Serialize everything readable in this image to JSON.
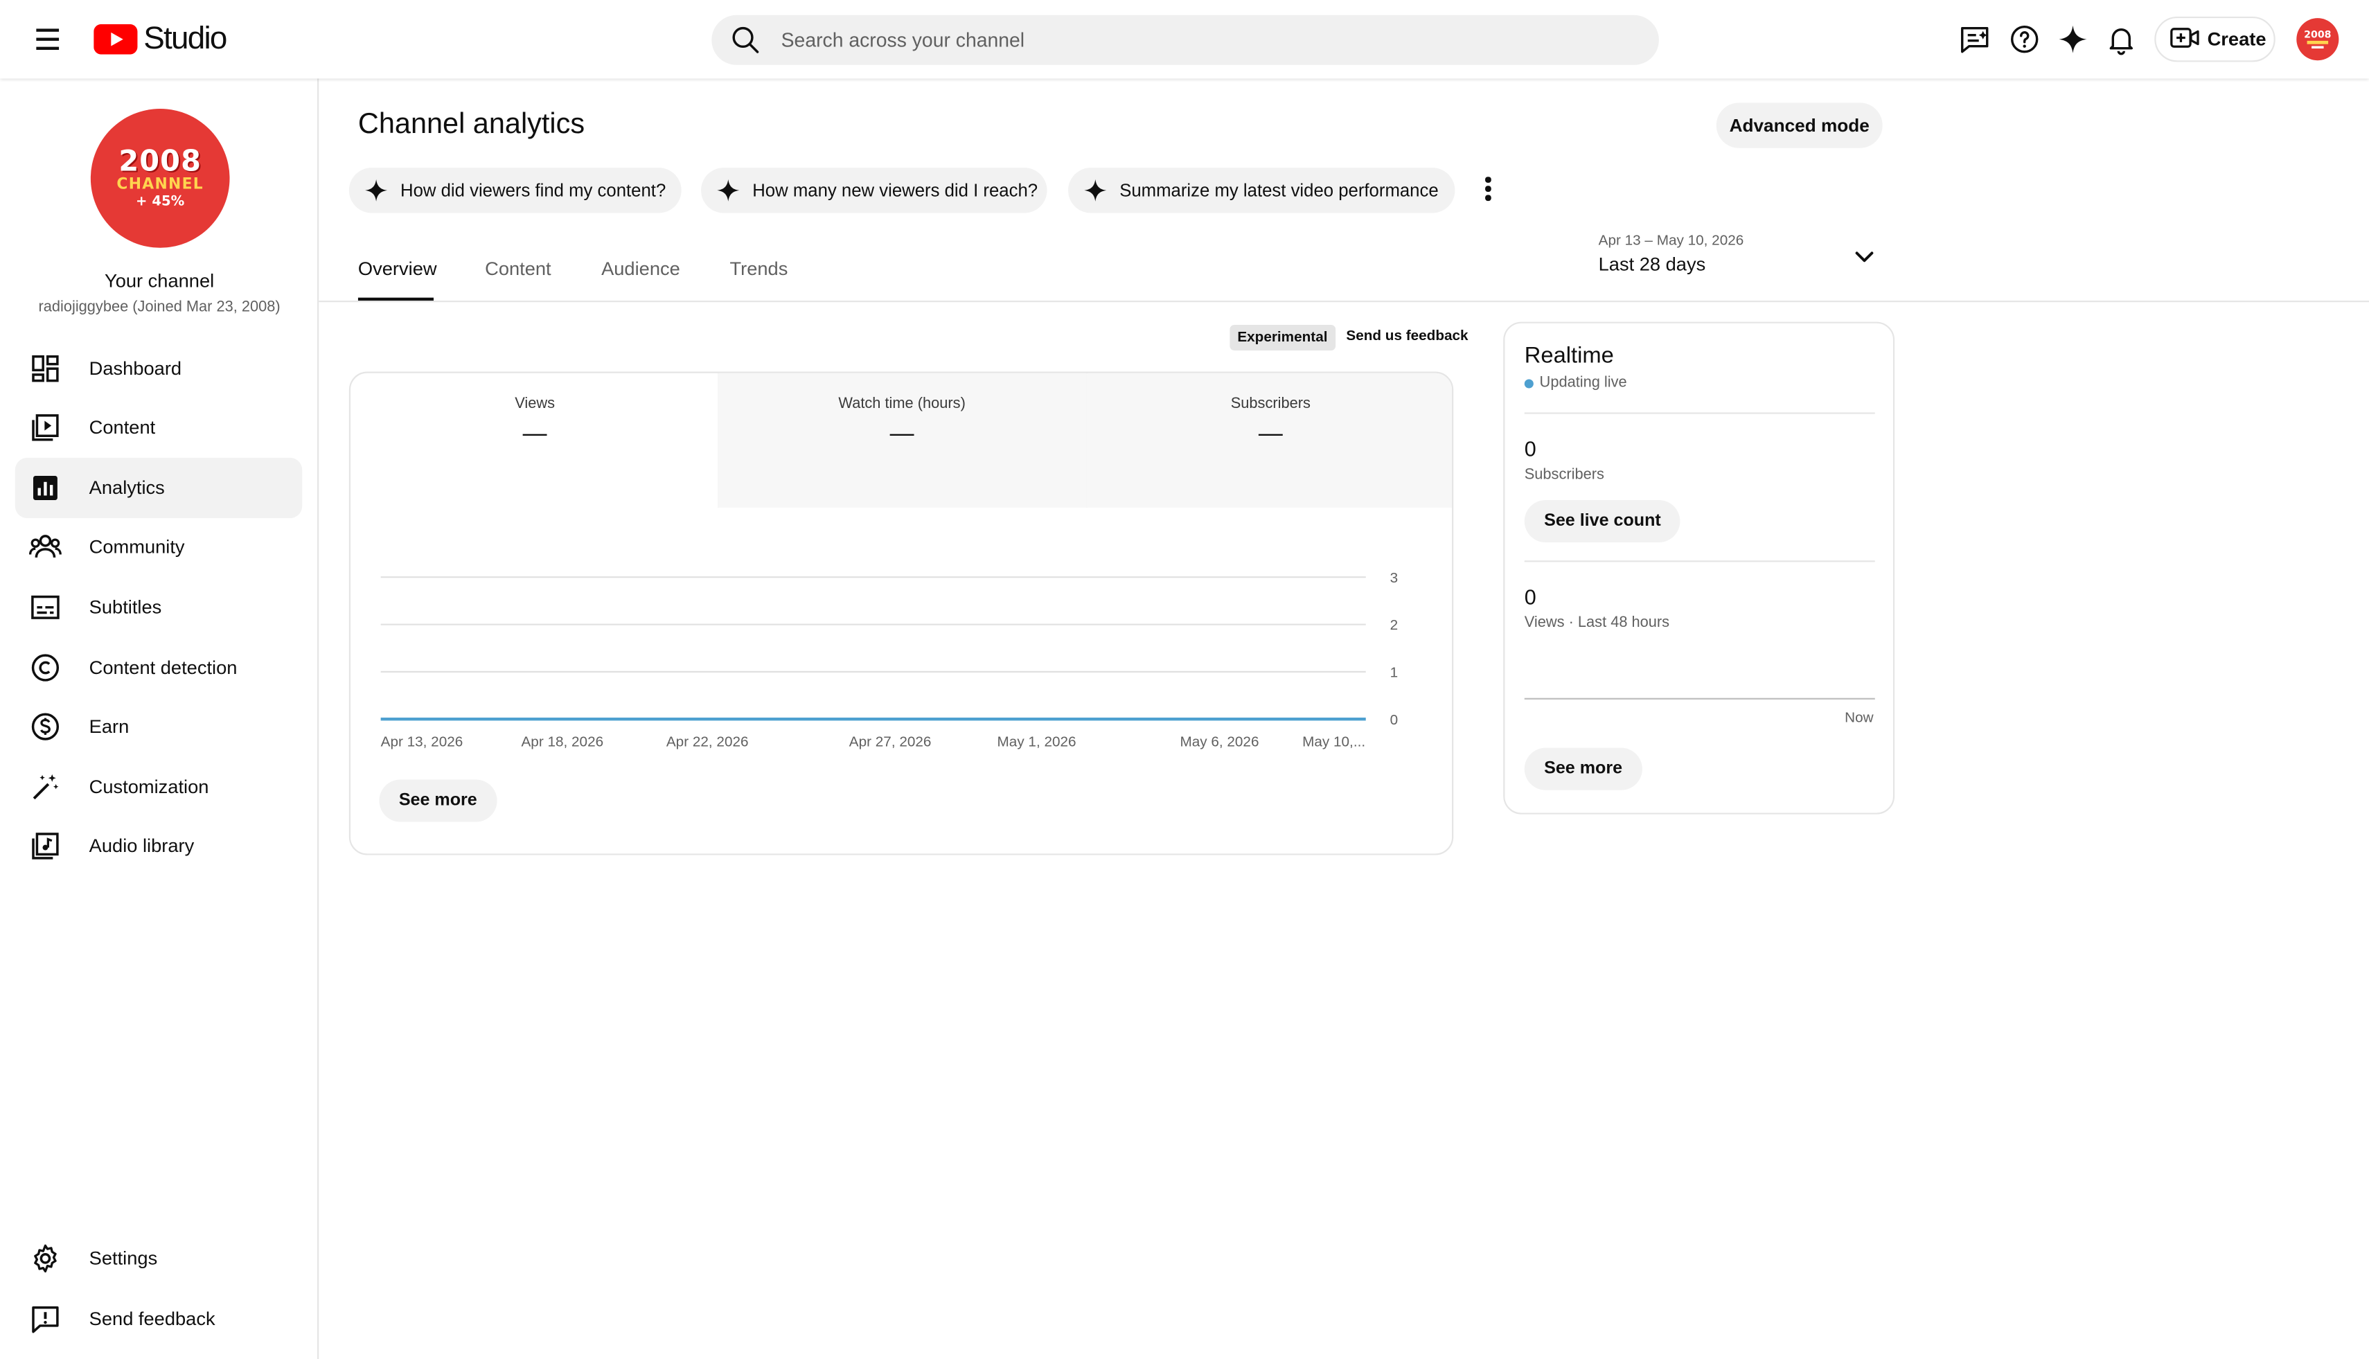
{
  "header": {
    "app_name": "Studio",
    "search_placeholder": "Search across your channel",
    "create_label": "Create",
    "brand_color": "#ff0000"
  },
  "sidebar": {
    "channel_avatar_text": [
      "2008",
      "CHANNEL",
      "+ 45%"
    ],
    "channel_name": "Your channel",
    "channel_sub": "radiojiggybee (Joined Mar 23, 2008)",
    "items": [
      {
        "label": "Dashboard",
        "icon": "dashboard-icon"
      },
      {
        "label": "Content",
        "icon": "content-icon"
      },
      {
        "label": "Analytics",
        "icon": "analytics-icon",
        "active": true
      },
      {
        "label": "Community",
        "icon": "community-icon"
      },
      {
        "label": "Subtitles",
        "icon": "subtitles-icon"
      },
      {
        "label": "Content detection",
        "icon": "copyright-icon"
      },
      {
        "label": "Earn",
        "icon": "dollar-icon"
      },
      {
        "label": "Customization",
        "icon": "magic-wand-icon"
      },
      {
        "label": "Audio library",
        "icon": "audio-library-icon"
      }
    ],
    "bottom_items": [
      {
        "label": "Settings",
        "icon": "gear-icon"
      },
      {
        "label": "Send feedback",
        "icon": "feedback-icon"
      }
    ]
  },
  "main": {
    "title": "Channel analytics",
    "advanced_mode_label": "Advanced mode",
    "chips": [
      "How did viewers find my content?",
      "How many new viewers did I reach?",
      "Summarize my latest video performance"
    ],
    "tabs": [
      "Overview",
      "Content",
      "Audience",
      "Trends"
    ],
    "active_tab": "Overview",
    "date_range": {
      "dates": "Apr 13 – May 10, 2026",
      "label": "Last 28 days"
    },
    "experimental_label": "Experimental",
    "feedback_label": "Send us feedback",
    "metrics": [
      {
        "label": "Views",
        "value": "—"
      },
      {
        "label": "Watch time (hours)",
        "value": "—"
      },
      {
        "label": "Subscribers",
        "value": "—"
      }
    ],
    "see_more_label": "See more"
  },
  "chart_data": {
    "type": "line",
    "x": [
      "Apr 13, 2026",
      "Apr 18, 2026",
      "Apr 22, 2026",
      "Apr 27, 2026",
      "May 1, 2026",
      "May 6, 2026",
      "May 10,..."
    ],
    "series": [
      {
        "values": [
          0,
          0,
          0,
          0,
          0,
          0,
          0
        ]
      }
    ],
    "yticks": [
      0,
      1,
      2,
      3
    ],
    "ylim": [
      0,
      3
    ],
    "grid": true,
    "line_color": "#4ea0d0"
  },
  "realtime": {
    "title": "Realtime",
    "status": "Updating live",
    "subscribers_value": "0",
    "subscribers_label": "Subscribers",
    "see_live_count_label": "See live count",
    "views_value": "0",
    "views_label": "Views · Last 48 hours",
    "now_label": "Now",
    "see_more_label": "See more"
  }
}
